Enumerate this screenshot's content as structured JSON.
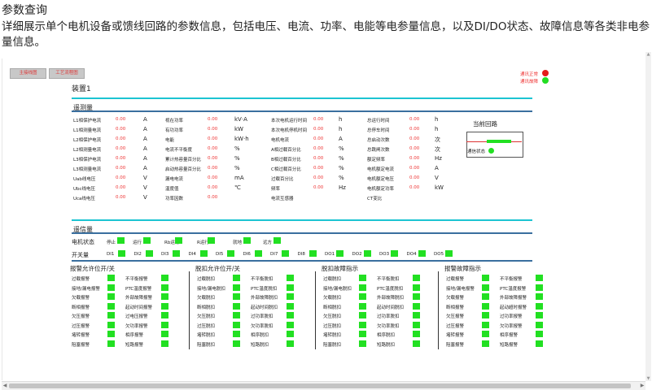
{
  "intro": {
    "title": "参数查询",
    "desc": "详细展示单个电机设备或馈线回路的参数信息，包括电压、电流、功率、电能等电参量信息，以及DI/DO状态、故障信息等各类非电参量信息。"
  },
  "toolbar": {
    "btn1": "主接线图",
    "btn2": "工艺流程图"
  },
  "status": {
    "comm_label": "通讯正常",
    "comm_color": "#e31b1b",
    "run_label": "通讯故障",
    "run_color": "#22dd22"
  },
  "device": {
    "name": "装置1"
  },
  "measure": {
    "title": "遥测量",
    "columns": [
      [
        {
          "label": "L1相保护电流",
          "value": "0.00",
          "unit": "A"
        },
        {
          "label": "L1相测量电流",
          "value": "0.00",
          "unit": "A"
        },
        {
          "label": "L2相保护电流",
          "value": "0.00",
          "unit": "A"
        },
        {
          "label": "L2相测量电流",
          "value": "0.00",
          "unit": "A"
        },
        {
          "label": "L3相保护电流",
          "value": "0.00",
          "unit": "A"
        },
        {
          "label": "L3相测量电流",
          "value": "0.00",
          "unit": "A"
        },
        {
          "label": "Uab线电压",
          "value": "0.00",
          "unit": "V"
        },
        {
          "label": "Ubc线电压",
          "value": "0.00",
          "unit": "V"
        },
        {
          "label": "Uca线电压",
          "value": "0.00",
          "unit": "V"
        }
      ],
      [
        {
          "label": "视在功率",
          "value": "0.00",
          "unit": "kV·A"
        },
        {
          "label": "有功功率",
          "value": "0.00",
          "unit": "kW"
        },
        {
          "label": "电能",
          "value": "0.00",
          "unit": "kW·h"
        },
        {
          "label": "电流不平衡度",
          "value": "0.00",
          "unit": "%"
        },
        {
          "label": "累计热容量百分比",
          "value": "0.00",
          "unit": "%"
        },
        {
          "label": "启动热容量百分比",
          "value": "0.00",
          "unit": "%"
        },
        {
          "label": "漏电电流",
          "value": "0.00",
          "unit": "mA"
        },
        {
          "label": "温度值",
          "value": "0.00",
          "unit": "℃"
        },
        {
          "label": "功率因数",
          "value": "0.00",
          "unit": ""
        }
      ],
      [
        {
          "label": "本次电机运行时间",
          "value": "0.00",
          "unit": "h"
        },
        {
          "label": "本次电机停机时间",
          "value": "0.00",
          "unit": "h"
        },
        {
          "label": "电机电流",
          "value": "0.00",
          "unit": "A"
        },
        {
          "label": "A相过载百分比",
          "value": "0.00",
          "unit": "%"
        },
        {
          "label": "B相过载百分比",
          "value": "0.00",
          "unit": "%"
        },
        {
          "label": "C相过载百分比",
          "value": "0.00",
          "unit": "%"
        },
        {
          "label": "过载百分比",
          "value": "0.00",
          "unit": "%"
        },
        {
          "label": "频率",
          "value": "0.00",
          "unit": "Hz"
        },
        {
          "label": "电流互感器",
          "value": "",
          "unit": ""
        }
      ],
      [
        {
          "label": "总运行时间",
          "value": "0.00",
          "unit": "h"
        },
        {
          "label": "总停车时间",
          "value": "0.00",
          "unit": "h"
        },
        {
          "label": "总启动次数",
          "value": "0.00",
          "unit": "次"
        },
        {
          "label": "总跳闸次数",
          "value": "0.00",
          "unit": "次"
        },
        {
          "label": "额定频率",
          "value": "0.00",
          "unit": "Hz"
        },
        {
          "label": "电机额定电流",
          "value": "0.00",
          "unit": "A"
        },
        {
          "label": "电机额定电压",
          "value": "0.00",
          "unit": "V"
        },
        {
          "label": "电机额定功率",
          "value": "0.00",
          "unit": "kW"
        },
        {
          "label": "CT变比",
          "value": "",
          "unit": ""
        }
      ]
    ],
    "current_loop": {
      "title": "当前回路",
      "state_label": "通信状态"
    }
  },
  "signals": {
    "title": "遥信量",
    "motor_label": "电机状态",
    "motor_states": [
      "停止",
      "运行",
      "Rb运行",
      "R运行",
      "就地",
      "远方"
    ],
    "io_label": "开关量",
    "di": [
      "DI1",
      "DI2",
      "DI3",
      "DI4",
      "DI5",
      "DI6",
      "DI7",
      "DI8"
    ],
    "do": [
      "DO1",
      "DO2",
      "DO3",
      "DO4",
      "DO5"
    ]
  },
  "alarms": {
    "groups": [
      {
        "title": "报警允许位开/关",
        "items": [
          "过载报警",
          "不平衡报警",
          "接地/漏电报警",
          "PTC温度报警",
          "欠载报警",
          "外部故障报警",
          "断相报警",
          "起动时间报警",
          "欠压报警",
          "过电压报警",
          "过压报警",
          "欠功率报警",
          "堵转报警",
          "相序报警",
          "阻塞报警",
          "短路报警"
        ]
      },
      {
        "title": "脱扣允许位开/关",
        "items": [
          "过载脱扣",
          "不平衡脱扣",
          "接地/漏电脱扣",
          "PTC温度脱扣",
          "欠载脱扣",
          "外部故障脱扣",
          "断相脱扣",
          "起动时间脱扣",
          "欠压脱扣",
          "过功率脱扣",
          "过压脱扣",
          "欠功率脱扣",
          "堵转脱扣",
          "相序脱扣",
          "阻塞脱扣",
          "短路脱扣"
        ]
      },
      {
        "title": "脱扣故障指示",
        "items": [
          "过载脱扣",
          "不平衡脱扣",
          "接地/漏电脱扣",
          "PTC温度脱扣",
          "欠载脱扣",
          "外部故障脱扣",
          "断相脱扣",
          "起动时间脱扣",
          "欠压脱扣",
          "过功率脱扣",
          "过压脱扣",
          "欠功率脱扣",
          "堵转脱扣",
          "相序脱扣",
          "阻塞脱扣",
          "短路脱扣"
        ]
      },
      {
        "title": "报警故障指示",
        "items": [
          "过载报警",
          "不平衡报警",
          "接地/漏电报警",
          "PTC温度报警",
          "欠载报警",
          "外部故障报警",
          "断相报警",
          "起动超时报警",
          "欠压报警",
          "过功率报警",
          "过压报警",
          "欠功率报警",
          "堵转报警",
          "相序报警",
          "阻塞报警",
          "短路报警"
        ]
      }
    ]
  },
  "colors": {
    "indicator": "#22e022",
    "accent": "#1cc4d2",
    "value": "#e31b1b"
  }
}
